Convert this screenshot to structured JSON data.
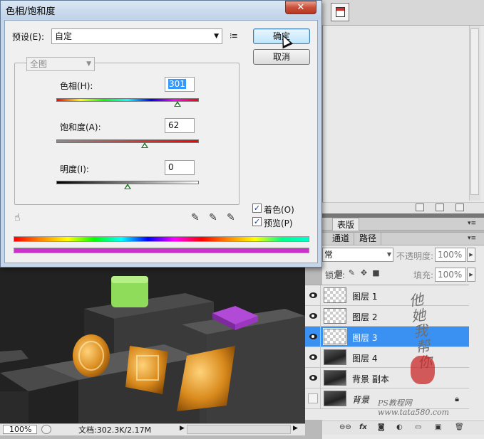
{
  "dialog": {
    "title": "色相/饱和度",
    "close_glyph": "✕",
    "preset": {
      "label": "预设(E):",
      "value": "自定"
    },
    "buttons": {
      "ok": "确定",
      "cancel": "取消"
    },
    "channel": {
      "value": "全图"
    },
    "hue": {
      "label": "色相(H):",
      "value": "301",
      "level_fraction": 0.85
    },
    "saturation": {
      "label": "饱和度(A):",
      "value": "62",
      "level_fraction": 0.62
    },
    "lightness": {
      "label": "明度(I):",
      "value": "0",
      "level_fraction": 0.5
    },
    "colorize": {
      "label": "着色(O)",
      "checked": true,
      "mark": "✓"
    },
    "preview": {
      "label": "预览(P)",
      "checked": true,
      "mark": "✓"
    }
  },
  "panels": {
    "tab_top": "表版",
    "tabs": [
      "通道",
      "路径"
    ],
    "blend_mode": "常",
    "opacity_label": "不透明度:",
    "opacity_value": "100%",
    "lock_label": "锁定:",
    "fill_label": "填充:",
    "fill_value": "100%",
    "layers": [
      {
        "name": "图层 1",
        "visible": true,
        "selected": false
      },
      {
        "name": "图层 2",
        "visible": true,
        "selected": false
      },
      {
        "name": "图层 3",
        "visible": true,
        "selected": true
      },
      {
        "name": "图层 4",
        "visible": true,
        "selected": false
      },
      {
        "name": "背景 副本",
        "visible": true,
        "selected": false
      },
      {
        "name": "背景",
        "visible": false,
        "selected": false,
        "locked": true
      }
    ]
  },
  "status": {
    "zoom": "100%",
    "doc_info": "文档:302.3K/2.17M"
  },
  "watermark": {
    "text": "PS教程网 www.tata580.com",
    "signature": "他她我帮你"
  }
}
